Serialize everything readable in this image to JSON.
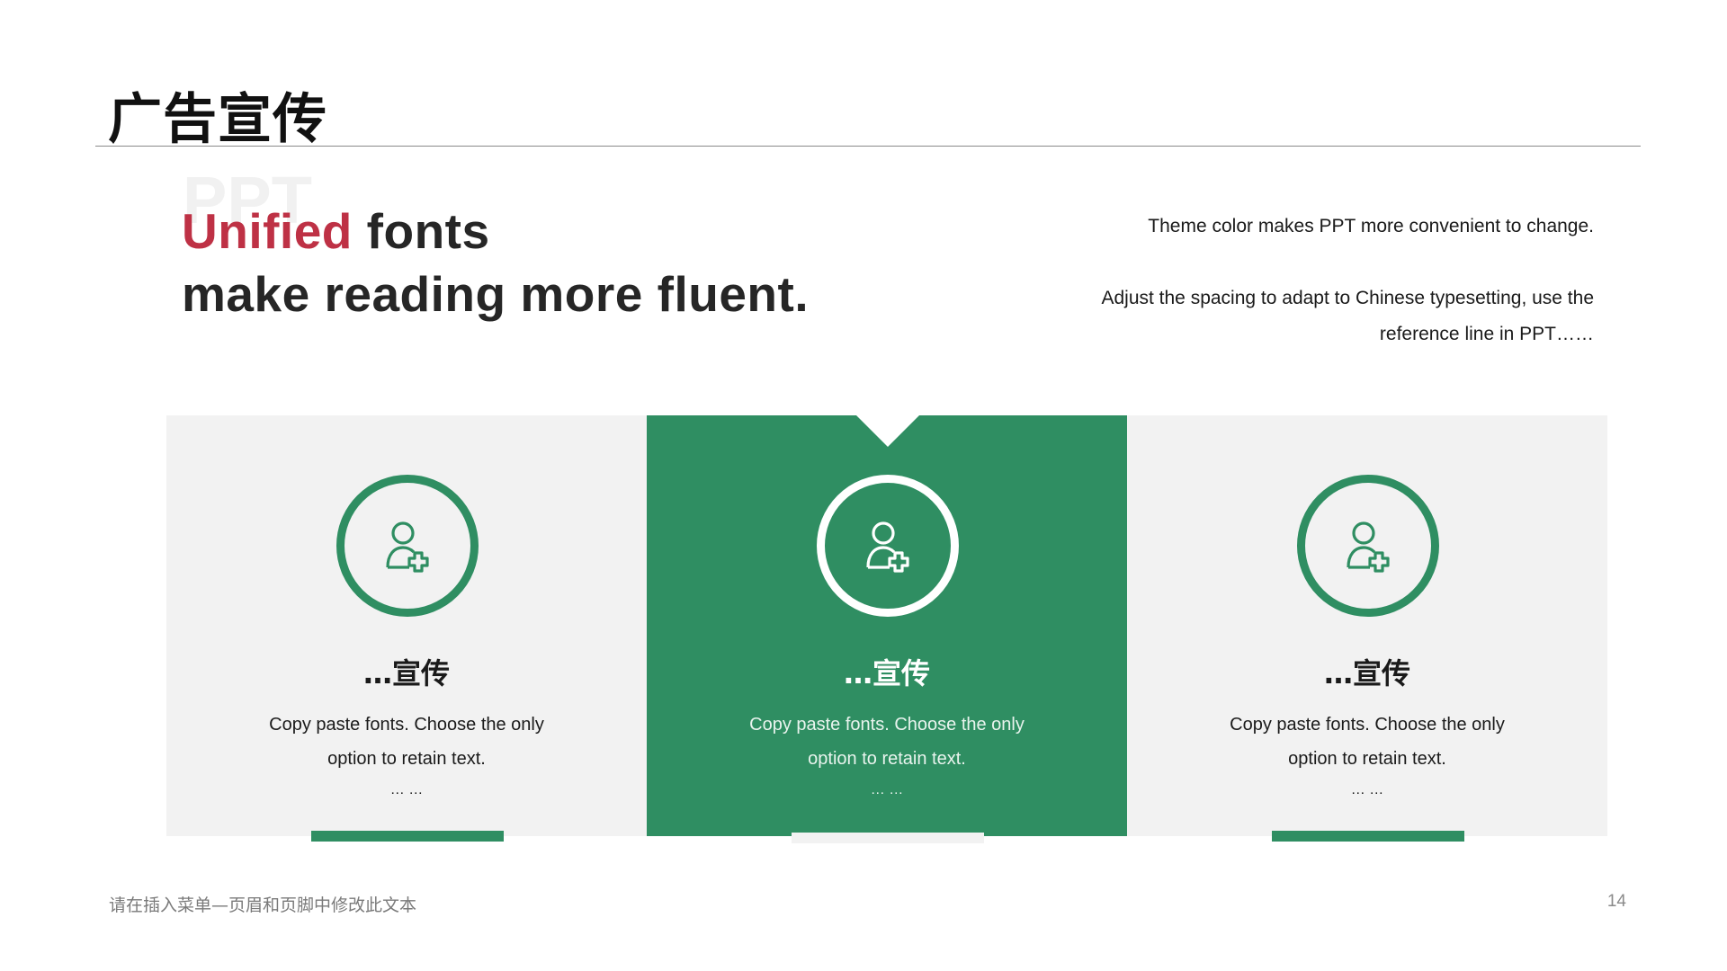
{
  "header": {
    "title": "广告宣传"
  },
  "hero": {
    "watermark": "PPT",
    "line1_accent": "Unified",
    "line1_rest": " fonts",
    "line2": "make reading more fluent."
  },
  "side_text": {
    "line1": "Theme color makes PPT more convenient to change.",
    "line2": "Adjust the spacing to adapt to Chinese typesetting, use the",
    "line3": "reference line in PPT……"
  },
  "cards": [
    {
      "title": "…宣传",
      "desc_line1": "Copy paste fonts. Choose the only",
      "desc_line2": "option to retain text.",
      "dots": "… …",
      "icon": "user-add-icon"
    },
    {
      "title": "…宣传",
      "desc_line1": "Copy paste fonts. Choose the only",
      "desc_line2": "option to retain text.",
      "dots": "… …",
      "icon": "user-add-icon"
    },
    {
      "title": "…宣传",
      "desc_line1": "Copy paste fonts. Choose the only",
      "desc_line2": "option to retain text.",
      "dots": "… …",
      "icon": "user-add-icon"
    }
  ],
  "footer": {
    "text": "请在插入菜单—页眉和页脚中修改此文本",
    "page_number": "14"
  },
  "colors": {
    "accent": "#be3145",
    "green": "#2f8e62",
    "card_bg": "#f2f2f2"
  }
}
